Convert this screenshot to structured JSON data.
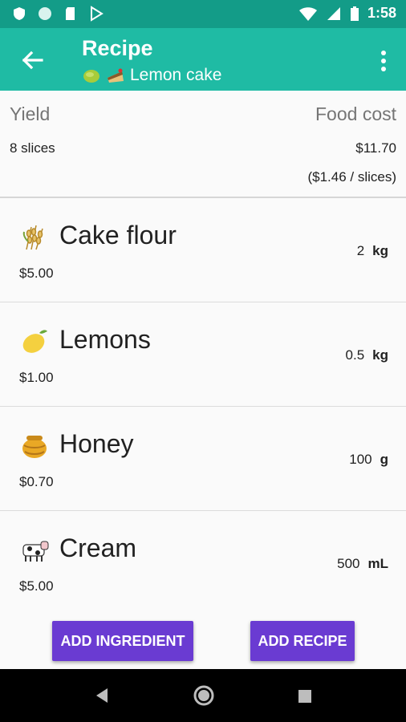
{
  "status_bar": {
    "time": "1:58"
  },
  "app_bar": {
    "title": "Recipe",
    "subtitle": "Lemon cake"
  },
  "summary": {
    "yield_label": "Yield",
    "yield_value": "8 slices",
    "cost_label": "Food cost",
    "cost_value": "$11.70",
    "cost_per": "($1.46 / slices)"
  },
  "ingredients": [
    {
      "name": "Cake flour",
      "price": "$5.00",
      "qty": "2",
      "unit": "kg",
      "icon": "wheat-icon"
    },
    {
      "name": "Lemons",
      "price": "$1.00",
      "qty": "0.5",
      "unit": "kg",
      "icon": "lemon-icon"
    },
    {
      "name": "Honey",
      "price": "$0.70",
      "qty": "100",
      "unit": "g",
      "icon": "honey-pot-icon"
    },
    {
      "name": "Cream",
      "price": "$5.00",
      "qty": "500",
      "unit": "mL",
      "icon": "cow-icon"
    }
  ],
  "actions": {
    "add_ingredient": "ADD INGREDIENT",
    "add_recipe": "ADD RECIPE"
  },
  "colors": {
    "status_bar": "#139c88",
    "app_bar": "#1fbba4",
    "button": "#6a3bd2"
  }
}
